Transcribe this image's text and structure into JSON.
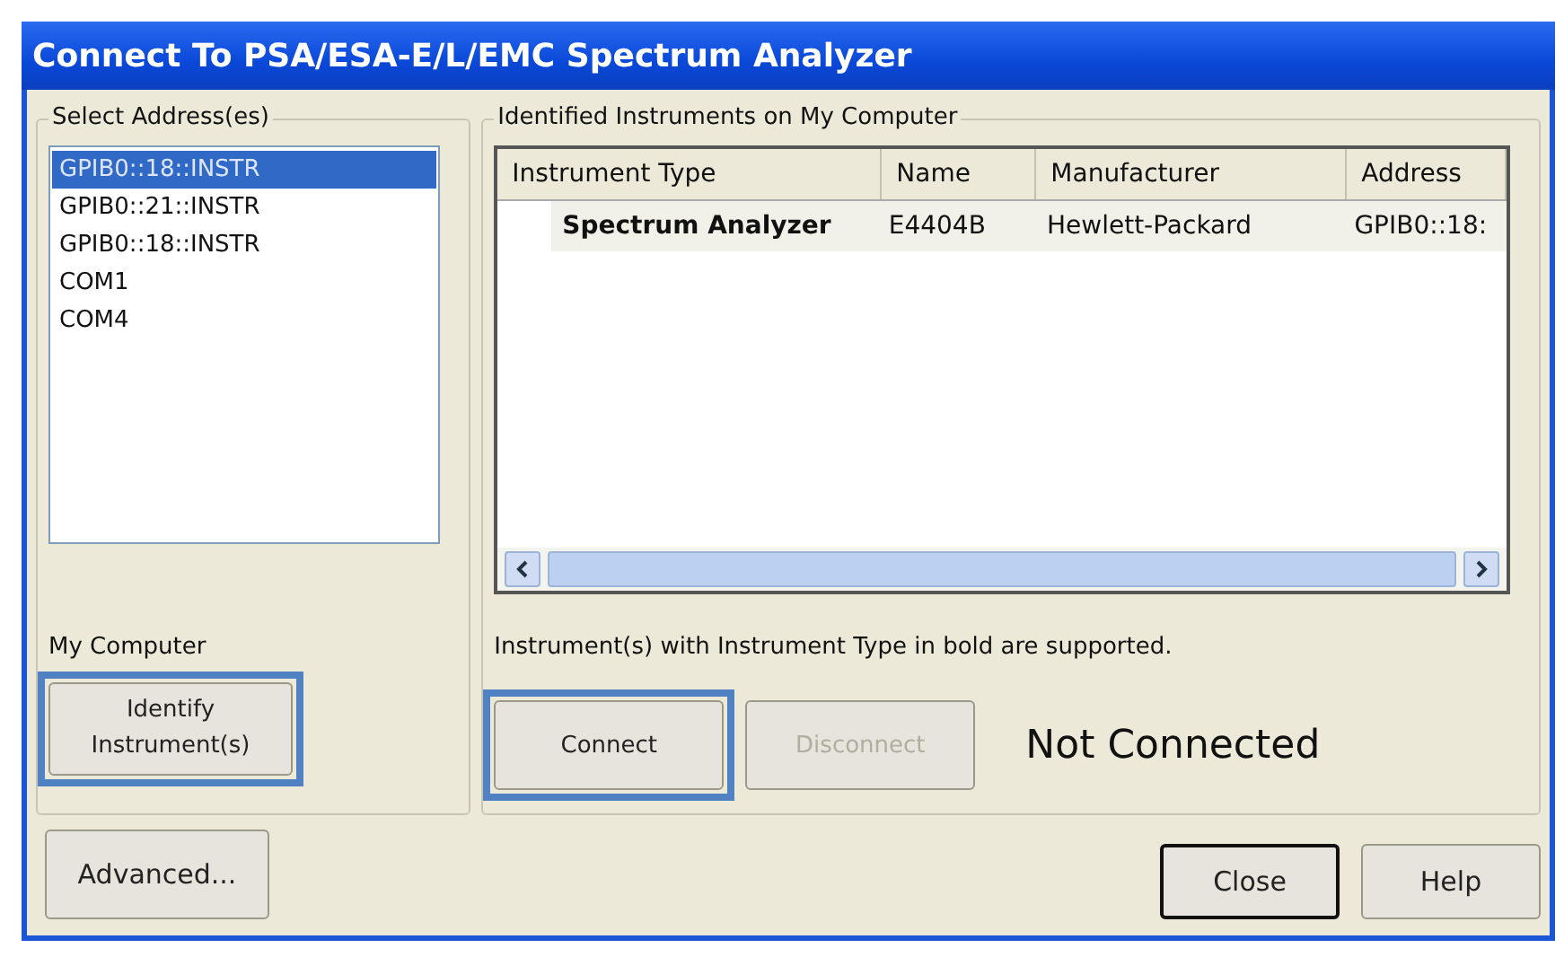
{
  "window": {
    "title": "Connect To PSA/ESA-E/L/EMC Spectrum Analyzer"
  },
  "address_group": {
    "label": "Select Address(es)",
    "items": [
      {
        "label": "GPIB0::18::INSTR",
        "selected": true
      },
      {
        "label": "GPIB0::21::INSTR",
        "selected": false
      },
      {
        "label": "GPIB0::18::INSTR",
        "selected": false
      },
      {
        "label": "COM1",
        "selected": false
      },
      {
        "label": "COM4",
        "selected": false
      }
    ],
    "caption": "My Computer",
    "identify_button": {
      "label": "Identify Instrument(s)",
      "highlighted": true,
      "disabled": false
    }
  },
  "instruments_group": {
    "label": "Identified Instruments on My Computer",
    "table": {
      "columns": [
        "Instrument Type",
        "Name",
        "Manufacturer",
        "Address"
      ],
      "rows": [
        {
          "cells": [
            "Spectrum Analyzer",
            "E4404B",
            "Hewlett-Packard",
            "GPIB0::18:"
          ],
          "supported": true
        }
      ]
    },
    "note": "Instrument(s) with Instrument Type in bold are supported.",
    "buttons": [
      {
        "label": "Connect",
        "highlighted": true,
        "disabled": false
      },
      {
        "label": "Disconnect",
        "highlighted": false,
        "disabled": true
      }
    ],
    "status": "Not Connected"
  },
  "footer": {
    "advanced": "Advanced...",
    "buttons": [
      {
        "label": "Close",
        "default": true
      },
      {
        "label": "Help",
        "default": false
      }
    ]
  }
}
